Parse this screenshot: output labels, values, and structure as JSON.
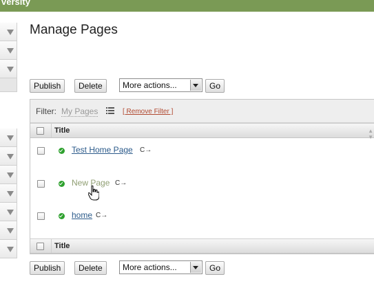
{
  "header": {
    "brand_fragment": "versity"
  },
  "page": {
    "title": "Manage Pages"
  },
  "toolbar_top": {
    "publish_label": "Publish",
    "delete_label": "Delete",
    "more_actions_value": "More actions...",
    "go_label": "Go"
  },
  "filter": {
    "label": "Filter:",
    "value": "My Pages",
    "remove_label": "[ Remove Filter ]"
  },
  "table": {
    "header_title": "Title",
    "footer_title": "Title",
    "rows": [
      {
        "title": "Test Home Page",
        "status": "published",
        "hovered": false
      },
      {
        "title": "New Page",
        "status": "published",
        "hovered": true
      },
      {
        "title": "home",
        "status": "published",
        "hovered": false
      }
    ]
  },
  "toolbar_bottom": {
    "publish_label": "Publish",
    "delete_label": "Delete",
    "more_actions_value": "More actions...",
    "go_label": "Go"
  },
  "icons": {
    "status": "check-circle-icon",
    "refresh": "refresh-icon",
    "filter_list": "list-icon",
    "dropdown": "chevron-down-icon",
    "sort": "sort-icon",
    "cursor": "hand-pointer-icon"
  },
  "colors": {
    "topbar": "#7a9a55",
    "link": "#2b5a8a",
    "link_hover": "#8f9e72",
    "status_ok": "#2fa12f",
    "remove_filter": "#b0472e"
  }
}
